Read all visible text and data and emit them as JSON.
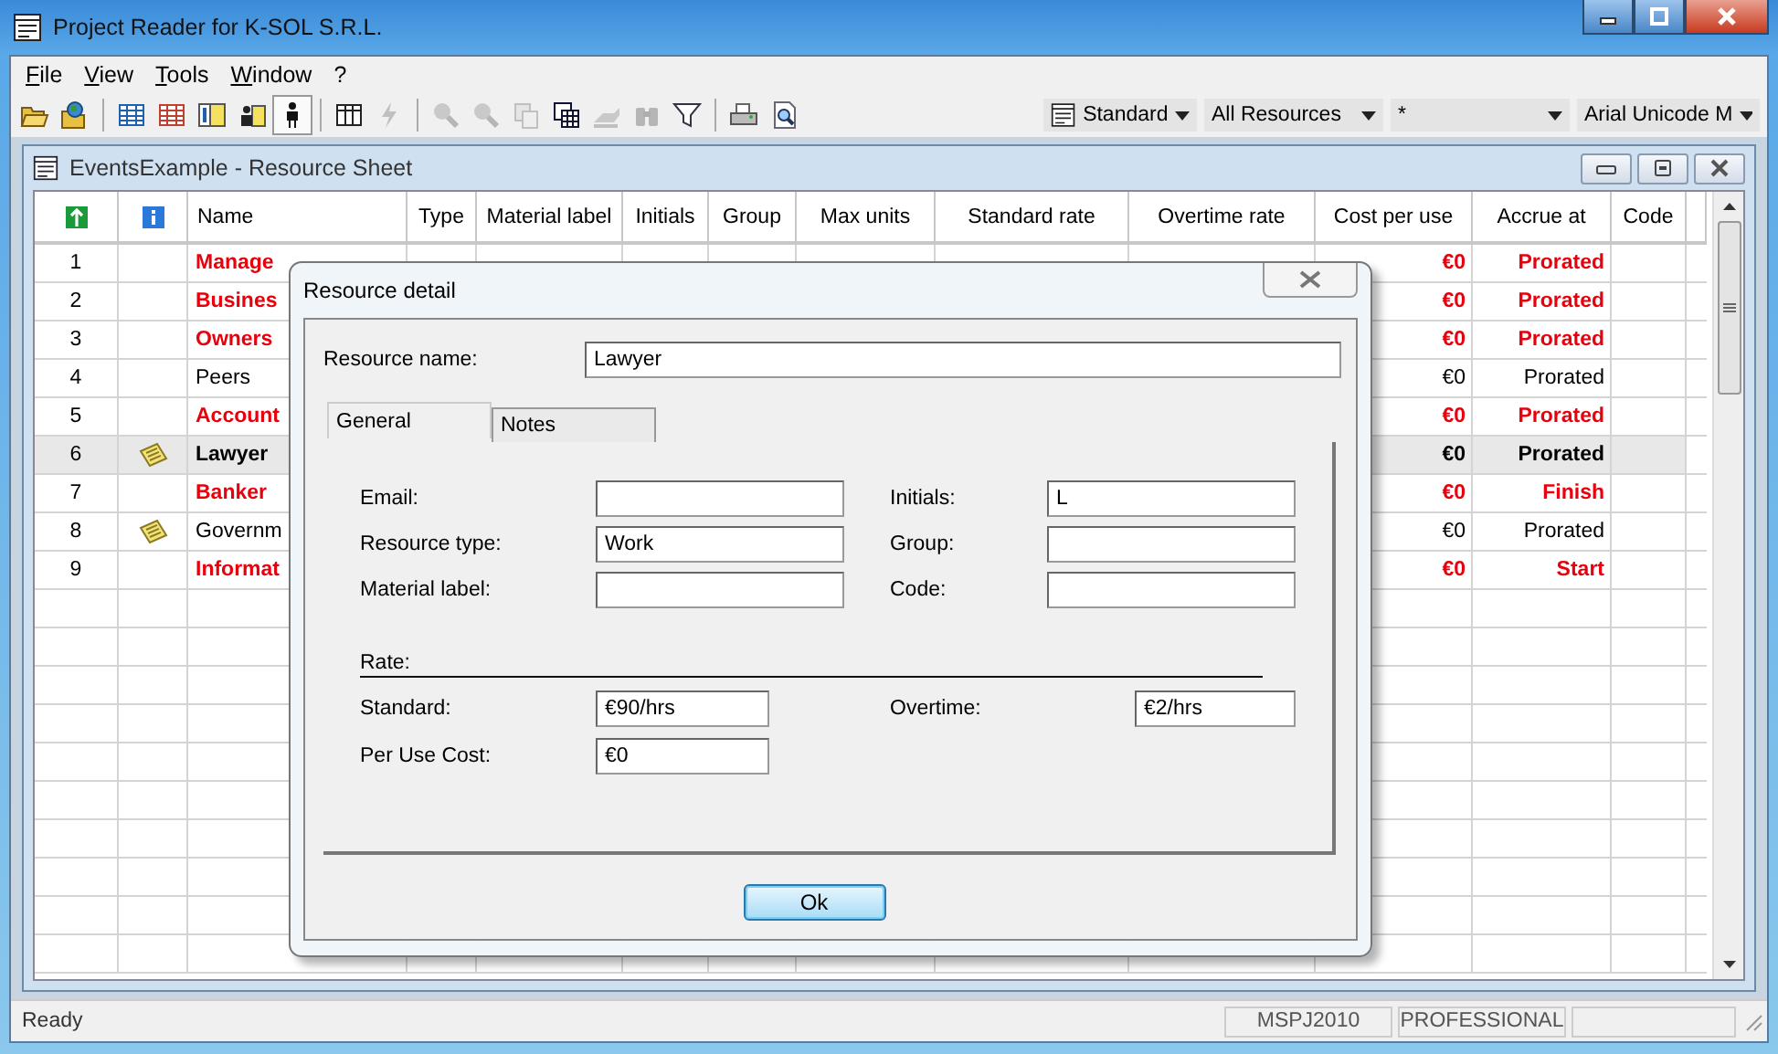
{
  "window": {
    "title": "Project Reader for K-SOL S.R.L."
  },
  "menu": [
    {
      "label": "File"
    },
    {
      "label": "View"
    },
    {
      "label": "Tools"
    },
    {
      "label": "Window"
    },
    {
      "label": "?"
    }
  ],
  "toolbar": [
    [
      {
        "kind": "open",
        "disabled": false,
        "pressed": false
      },
      {
        "kind": "web-open",
        "disabled": false,
        "pressed": false
      }
    ],
    [
      {
        "kind": "table-blue",
        "disabled": false,
        "pressed": false
      },
      {
        "kind": "table-red",
        "disabled": false,
        "pressed": false
      },
      {
        "kind": "columns",
        "disabled": false,
        "pressed": false
      },
      {
        "kind": "resource-sheet",
        "disabled": false,
        "pressed": false
      },
      {
        "kind": "person",
        "disabled": false,
        "pressed": true
      }
    ],
    [
      {
        "kind": "grid",
        "disabled": false,
        "pressed": false
      },
      {
        "kind": "lightning",
        "disabled": true,
        "pressed": false
      }
    ],
    [
      {
        "kind": "zoom-in",
        "disabled": true,
        "pressed": false
      },
      {
        "kind": "zoom-out",
        "disabled": true,
        "pressed": false
      },
      {
        "kind": "copy",
        "disabled": true,
        "pressed": false
      },
      {
        "kind": "grid-copy",
        "disabled": false,
        "pressed": false
      },
      {
        "kind": "hand",
        "disabled": true,
        "pressed": false
      },
      {
        "kind": "binoculars",
        "disabled": true,
        "pressed": false
      },
      {
        "kind": "filter",
        "disabled": false,
        "pressed": false
      }
    ],
    [
      {
        "kind": "print",
        "disabled": false,
        "pressed": false
      },
      {
        "kind": "preview",
        "disabled": false,
        "pressed": false
      }
    ]
  ],
  "dropdowns": [
    {
      "value": "Standard",
      "kind": "calendar"
    },
    {
      "value": "All Resources",
      "kind": "plain"
    },
    {
      "value": "*",
      "kind": "plain"
    },
    {
      "value": "Arial Unicode M",
      "kind": "plain"
    }
  ],
  "document": {
    "title": "EventsExample - Resource Sheet",
    "columns": [
      "Name",
      "Type",
      "Material label",
      "Initials",
      "Group",
      "Max units",
      "Standard rate",
      "Overtime rate",
      "Cost per use",
      "Accrue at",
      "Code"
    ],
    "rows": [
      {
        "id": "1",
        "note": false,
        "name": "Manage",
        "cost": "€0",
        "accrue": "Prorated",
        "highlight": true,
        "selected": false
      },
      {
        "id": "2",
        "note": false,
        "name": "Busines",
        "cost": "€0",
        "accrue": "Prorated",
        "highlight": true,
        "selected": false
      },
      {
        "id": "3",
        "note": false,
        "name": "Owners",
        "cost": "€0",
        "accrue": "Prorated",
        "highlight": true,
        "selected": false
      },
      {
        "id": "4",
        "note": false,
        "name": "Peers",
        "cost": "€0",
        "accrue": "Prorated",
        "highlight": false,
        "selected": false
      },
      {
        "id": "5",
        "note": false,
        "name": "Account",
        "cost": "€0",
        "accrue": "Prorated",
        "highlight": true,
        "selected": false
      },
      {
        "id": "6",
        "note": true,
        "name": "Lawyer",
        "cost": "€0",
        "accrue": "Prorated",
        "highlight": false,
        "selected": true
      },
      {
        "id": "7",
        "note": false,
        "name": "Banker",
        "cost": "€0",
        "accrue": "Finish",
        "highlight": true,
        "selected": false
      },
      {
        "id": "8",
        "note": true,
        "name": "Governm",
        "cost": "€0",
        "accrue": "Prorated",
        "highlight": false,
        "selected": false
      },
      {
        "id": "9",
        "note": false,
        "name": "Informat",
        "cost": "€0",
        "accrue": "Start",
        "highlight": true,
        "selected": false
      }
    ]
  },
  "dialog": {
    "title": "Resource detail",
    "name_label": "Resource name:",
    "name_value": "Lawyer",
    "tabs": [
      {
        "label": "General",
        "selected": true
      },
      {
        "label": "Notes",
        "selected": false
      }
    ],
    "fields": [
      {
        "label": "Email:"
      },
      {
        "label": "Initials:",
        "value": "L"
      },
      {
        "label": "Resource type:",
        "value": "Work"
      },
      {
        "label": "Group:"
      },
      {
        "label": "Material label:"
      },
      {
        "label": "Code:"
      }
    ],
    "rate_title": "Rate:",
    "rates": [
      {
        "label": "Standard:",
        "value": "€90/hrs"
      },
      {
        "label": "Overtime:",
        "value": "€2/hrs"
      },
      {
        "label": "Per Use Cost:",
        "value": "€0"
      }
    ],
    "button": "Ok"
  },
  "status_bar": {
    "message": "Ready",
    "panels": [
      "MSPJ2010",
      "PROFESSIONAL"
    ]
  }
}
